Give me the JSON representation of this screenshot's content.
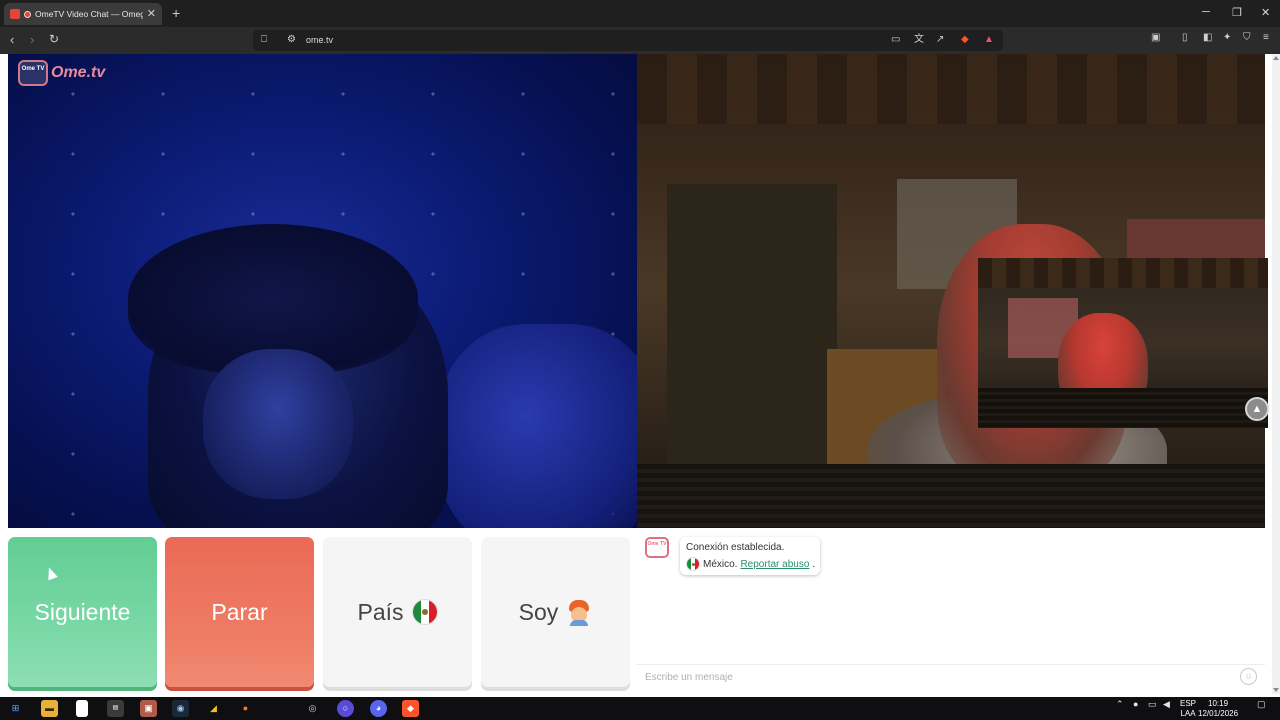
{
  "browser": {
    "tab_title": "OmeTV Video Chat — Omegl",
    "new_tab": "+",
    "url": "ome.tv",
    "window_controls": {
      "minimize": "─",
      "maximize": "❐",
      "close": "✕"
    }
  },
  "site": {
    "logo_badge": "Ome TV",
    "logo_text": "Ome.tv"
  },
  "controls": {
    "next_label": "Siguiente",
    "stop_label": "Parar",
    "country_label": "País",
    "gender_label": "Soy"
  },
  "chat": {
    "logo_badge": "Ome TV",
    "status": "Conexión establecida.",
    "country": "México.",
    "report_link": "Reportar abuso",
    "report_suffix": ".",
    "input_placeholder": "Escribe un mensaje"
  },
  "taskbar": {
    "lang_top": "ESP",
    "lang_bottom": "LAA",
    "time": "10:19",
    "date": "12/01/2026"
  }
}
